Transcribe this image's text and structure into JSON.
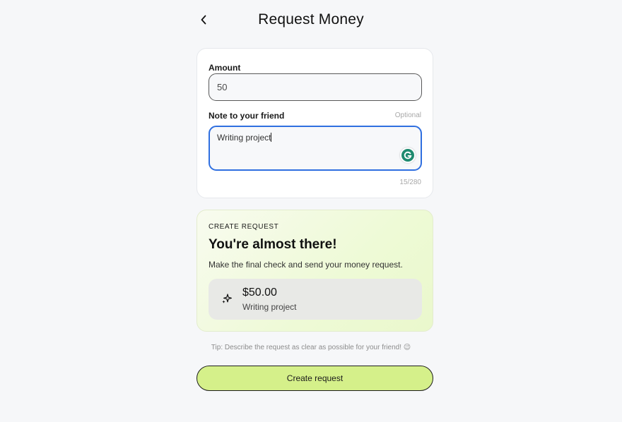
{
  "header": {
    "title": "Request Money",
    "back_icon": "chevron-left-icon"
  },
  "form": {
    "amount_label": "Amount",
    "amount_value": "50",
    "note_label": "Note to your friend",
    "note_optional": "Optional",
    "note_value": "Writing project",
    "note_counter": "15/280",
    "extension_icon": "grammarly-icon",
    "focus_color": "#2f6fe0"
  },
  "summary": {
    "eyebrow": "CREATE REQUEST",
    "headline": "You're almost there!",
    "description": "Make the final check and send your money request.",
    "preview_icon": "sparkle-icon",
    "preview_amount": "$50.00",
    "preview_note": "Writing project",
    "accent_color": "#eefad6"
  },
  "tip": "Tip: Describe the request as clear as possible for your friend! 😉",
  "cta": {
    "label": "Create request",
    "color": "#d5f08a"
  }
}
